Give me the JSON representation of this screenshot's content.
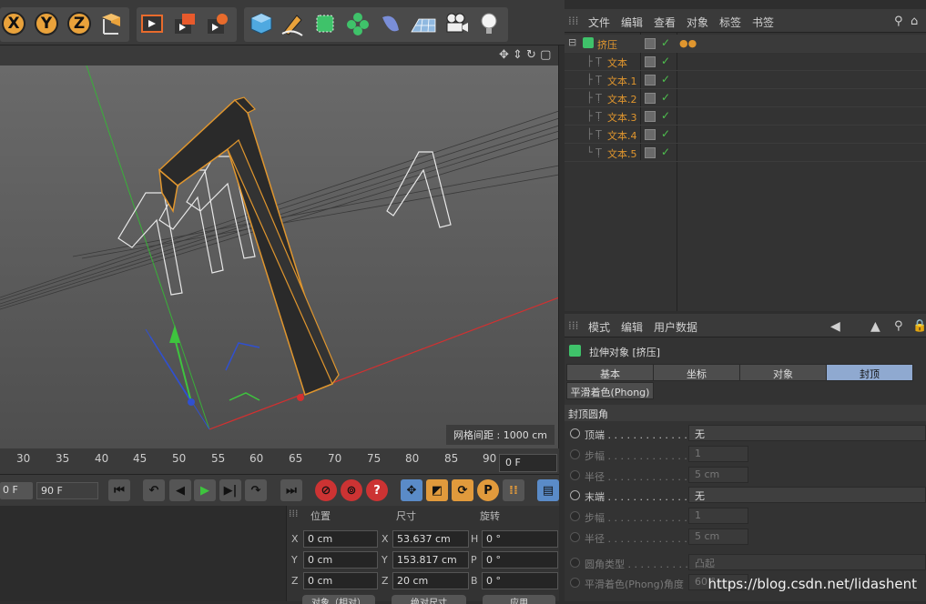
{
  "toolbar": {
    "axes": [
      "X",
      "Y",
      "Z"
    ],
    "icons": [
      "world-axis-icon",
      "render-view-icon",
      "render-picture-icon",
      "render-settings-icon",
      "cube-icon",
      "pen-icon",
      "nurbs-icon",
      "array-icon",
      "deformer-icon",
      "floor-icon",
      "camera-icon",
      "light-icon"
    ]
  },
  "viewport": {
    "grid_info": "网格间距 : 1000 cm"
  },
  "timeline": {
    "ticks": [
      "30",
      "35",
      "40",
      "45",
      "50",
      "55",
      "60",
      "65",
      "70",
      "75",
      "80",
      "85",
      "90"
    ],
    "frame_value": "0 F",
    "start_field": "0 F",
    "end_field": "90 F"
  },
  "coords": {
    "headers": {
      "position": "位置",
      "size": "尺寸",
      "rotation": "旋转"
    },
    "rows": [
      {
        "axis": "X",
        "pos": "0 cm",
        "size_axis": "X",
        "size": "53.637 cm",
        "rot_axis": "H",
        "rot": "0 °"
      },
      {
        "axis": "Y",
        "pos": "0 cm",
        "size_axis": "Y",
        "size": "153.817 cm",
        "rot_axis": "P",
        "rot": "0 °"
      },
      {
        "axis": "Z",
        "pos": "0 cm",
        "size_axis": "Z",
        "size": "20 cm",
        "rot_axis": "B",
        "rot": "0 °"
      }
    ],
    "buttons": [
      "对象（相对）",
      "绝对尺寸",
      "应用"
    ]
  },
  "object_manager": {
    "menu": [
      "文件",
      "编辑",
      "查看",
      "对象",
      "标签",
      "书签"
    ],
    "root": "挤压",
    "children": [
      "文本",
      "文本.1",
      "文本.2",
      "文本.3",
      "文本.4",
      "文本.5"
    ]
  },
  "attribute_manager": {
    "menu": [
      "模式",
      "编辑",
      "用户数据"
    ],
    "object_title": "拉伸对象 [挤压]",
    "tabs": [
      "基本",
      "坐标",
      "对象",
      "封顶"
    ],
    "active_tab": "封顶",
    "subtab": "平滑着色(Phong)",
    "section": "封顶圆角",
    "props": [
      {
        "label": "顶端 . . . . . . . . . . . . . .",
        "value": "无",
        "enabled": true,
        "radio": true
      },
      {
        "label": "步幅 . . . . . . . . . . . . . .",
        "value": "1",
        "enabled": false,
        "radio": true
      },
      {
        "label": "半径 . . . . . . . . . . . . . .",
        "value": "5 cm",
        "enabled": false,
        "radio": true
      },
      {
        "label": "末端 . . . . . . . . . . . . . .",
        "value": "无",
        "enabled": true,
        "radio": true
      },
      {
        "label": "步幅 . . . . . . . . . . . . . .",
        "value": "1",
        "enabled": false,
        "radio": true
      },
      {
        "label": "半径 . . . . . . . . . . . . . .",
        "value": "5 cm",
        "enabled": false,
        "radio": true
      },
      {
        "label": "圆角类型 . . . . . . . . . . .",
        "value": "凸起",
        "enabled": false,
        "radio": true
      },
      {
        "label": "平滑着色(Phong)角度",
        "value": "60 °",
        "enabled": false,
        "radio": true
      }
    ]
  },
  "watermark": "https://blog.csdn.net/lidashent"
}
